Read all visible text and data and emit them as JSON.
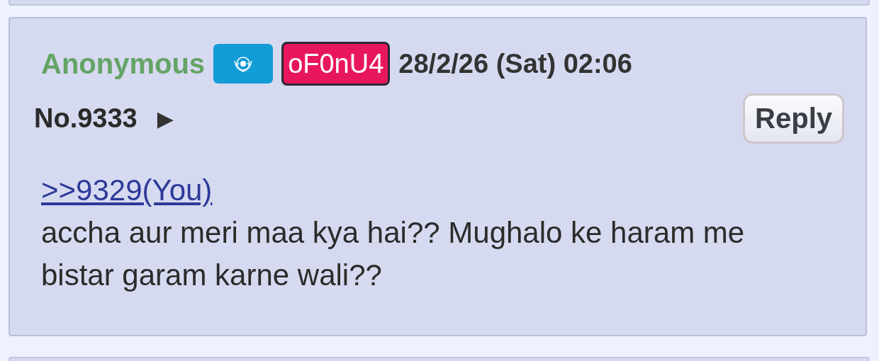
{
  "post": {
    "name": "Anonymous",
    "flag": {
      "kind": "un"
    },
    "poster_id": "oF0nU4",
    "datetime": "28/2/26 (Sat) 02:06",
    "number": "No.9333",
    "menu_arrow": "▶",
    "reply_button": "Reply",
    "quote_link": ">>9329(You)",
    "body": "accha aur meri maa kya hai?? Mughalo ke haram me bistar garam karne wali??"
  }
}
